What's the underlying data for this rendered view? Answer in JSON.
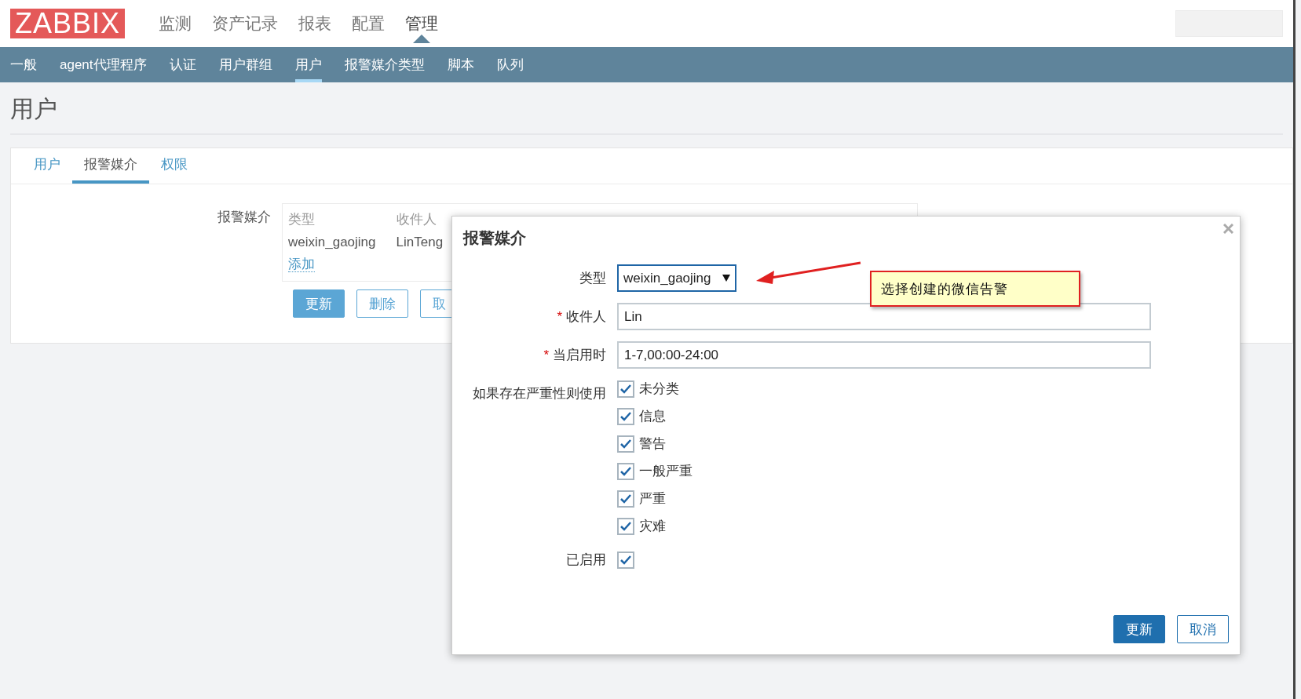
{
  "logo": "ZABBIX",
  "top_menu": [
    {
      "label": "监测",
      "selected": false
    },
    {
      "label": "资产记录",
      "selected": false
    },
    {
      "label": "报表",
      "selected": false
    },
    {
      "label": "配置",
      "selected": false
    },
    {
      "label": "管理",
      "selected": true
    }
  ],
  "sub_menu": [
    {
      "label": "一般",
      "selected": false
    },
    {
      "label": "agent代理程序",
      "selected": false
    },
    {
      "label": "认证",
      "selected": false
    },
    {
      "label": "用户群组",
      "selected": false
    },
    {
      "label": "用户",
      "selected": true
    },
    {
      "label": "报警媒介类型",
      "selected": false
    },
    {
      "label": "脚本",
      "selected": false
    },
    {
      "label": "队列",
      "selected": false
    }
  ],
  "page_title": "用户",
  "tabs": [
    {
      "label": "用户",
      "selected": false
    },
    {
      "label": "报警媒介",
      "selected": true
    },
    {
      "label": "权限",
      "selected": false
    }
  ],
  "media_field": {
    "label": "报警媒介",
    "columns": [
      "类型",
      "收件人"
    ],
    "rows": [
      [
        "weixin_gaojing",
        "LinTeng"
      ]
    ],
    "add_link": "添加"
  },
  "form_buttons": [
    {
      "label": "更新",
      "kind": "primary"
    },
    {
      "label": "删除",
      "kind": "secondary"
    },
    {
      "label": "取",
      "kind": "secondary"
    }
  ],
  "dialog": {
    "title": "报警媒介",
    "required_mark": "*",
    "fields": [
      {
        "kind": "select",
        "label": "类型",
        "value": "weixin_gaojing",
        "required": false
      },
      {
        "kind": "text",
        "label": "收件人",
        "value": "Lin",
        "required": true
      },
      {
        "kind": "text",
        "label": "当启用时",
        "value": "1-7,00:00-24:00",
        "required": true
      }
    ],
    "severity": {
      "label": "如果存在严重性则使用",
      "options": [
        {
          "label": "未分类",
          "checked": true
        },
        {
          "label": "信息",
          "checked": true
        },
        {
          "label": "警告",
          "checked": true
        },
        {
          "label": "一般严重",
          "checked": true
        },
        {
          "label": "严重",
          "checked": true
        },
        {
          "label": "灾难",
          "checked": true
        }
      ]
    },
    "enabled": {
      "label": "已启用",
      "checked": true
    },
    "buttons": [
      {
        "label": "更新",
        "kind": "primary"
      },
      {
        "label": "取消",
        "kind": "secondary"
      }
    ]
  },
  "annotation": {
    "text": "选择创建的微信告警"
  }
}
